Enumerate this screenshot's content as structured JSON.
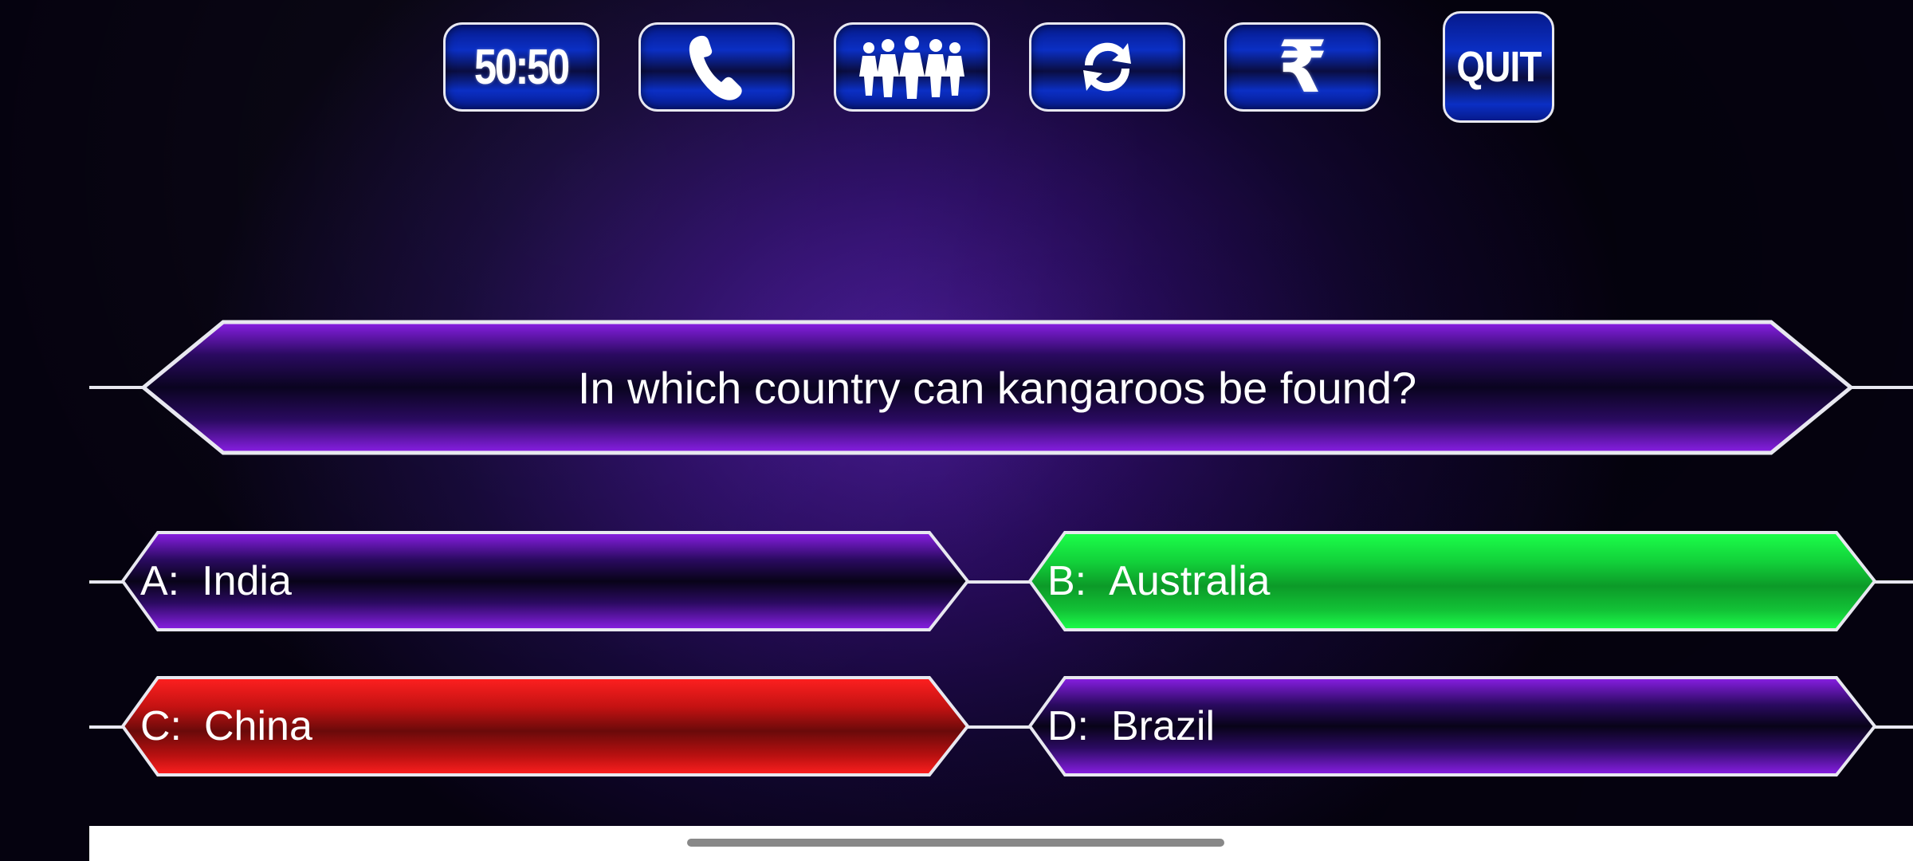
{
  "lifelines": {
    "fifty_fifty": "50:50",
    "phone": "phone-icon",
    "audience": "audience-icon",
    "switch": "refresh-icon",
    "money": "₹"
  },
  "quit_label": "QUIT",
  "question": "In which country can kangaroos be found?",
  "answers": [
    {
      "letter": "A:",
      "text": "India",
      "state": "normal"
    },
    {
      "letter": "B:",
      "text": "Australia",
      "state": "correct"
    },
    {
      "letter": "C:",
      "text": "China",
      "state": "wrong"
    },
    {
      "letter": "D:",
      "text": "Brazil",
      "state": "normal"
    }
  ],
  "colors": {
    "normal": "#7a1fd6",
    "correct": "#12d13a",
    "wrong": "#d41414",
    "border": "#e8e8f0"
  }
}
